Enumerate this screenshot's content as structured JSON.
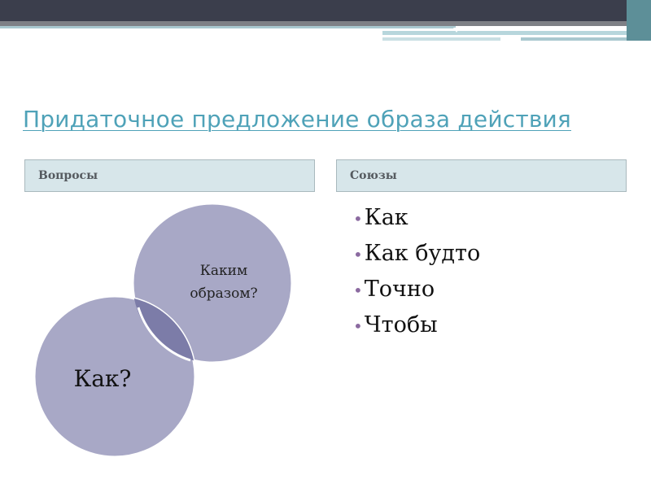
{
  "slide": {
    "title": "Придаточное предложение образа действия",
    "columns": [
      {
        "header": "Вопросы"
      },
      {
        "header": "Союзы"
      }
    ],
    "venn": {
      "circles": [
        {
          "label_lines": [
            "Каким",
            "образом?"
          ]
        },
        {
          "label": "Как?"
        }
      ],
      "fill": "#a8a8c6",
      "overlap_fill": "#7c7ca8",
      "stroke": "#ffffff"
    },
    "conjunctions": [
      "Как",
      "Как будто",
      "Точно",
      "Чтобы"
    ],
    "bullet_color": "#8b6aa0",
    "title_color": "#4fa2b8"
  }
}
